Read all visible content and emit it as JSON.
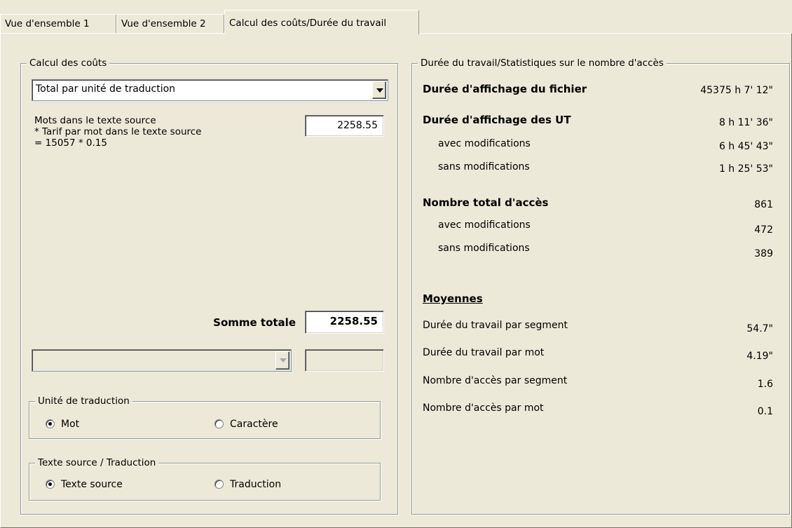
{
  "tabs": [
    {
      "label": "Vue d'ensemble 1",
      "active": false
    },
    {
      "label": "Vue d'ensemble 2",
      "active": false
    },
    {
      "label": "Calcul des coûts/Durée du travail",
      "active": true
    }
  ],
  "cost": {
    "group_label": "Calcul des coûts",
    "mode_selected": "Total par unité de traduction",
    "formula_lines": [
      "Mots dans le texte source",
      "* Tarif par mot dans le texte source",
      "= 15057 * 0.15"
    ],
    "subtotal_value": "2258.55",
    "total_label": "Somme totale",
    "total_value": "2258.55",
    "extra_select_value": "",
    "extra_value": "",
    "unit_group": {
      "label": "Unité de traduction",
      "options": [
        {
          "label": "Mot",
          "checked": true
        },
        {
          "label": "Caractère",
          "checked": false
        }
      ]
    },
    "text_group": {
      "label": "Texte source / Traduction",
      "options": [
        {
          "label": "Texte source",
          "checked": true
        },
        {
          "label": "Traduction",
          "checked": false
        }
      ]
    }
  },
  "stats": {
    "group_label": "Durée du travail/Statistiques sur le nombre d'accès",
    "file_display_label": "Durée d'affichage du fichier",
    "file_display_value": "45375 h 7' 12\"",
    "tu_display_label": "Durée d'affichage des UT",
    "tu_display_value": "8 h 11' 36\"",
    "tu_with_mod_label": "avec modifications",
    "tu_with_mod_value": "6 h 45' 43\"",
    "tu_without_mod_label": "sans modifications",
    "tu_without_mod_value": "1 h 25' 53\"",
    "access_total_label": "Nombre total d'accès",
    "access_total_value": "861",
    "access_with_mod_label": "avec modifications",
    "access_with_mod_value": "472",
    "access_without_mod_label": "sans modifications",
    "access_without_mod_value": "389",
    "averages_heading": "Moyennes",
    "avg_time_segment_label": "Durée du travail par segment",
    "avg_time_segment_value": "54.7\"",
    "avg_time_word_label": "Durée du travail par mot",
    "avg_time_word_value": "4.19\"",
    "avg_access_segment_label": "Nombre d'accès par segment",
    "avg_access_segment_value": "1.6",
    "avg_access_word_label": "Nombre d'accès par mot",
    "avg_access_word_value": "0.1"
  }
}
